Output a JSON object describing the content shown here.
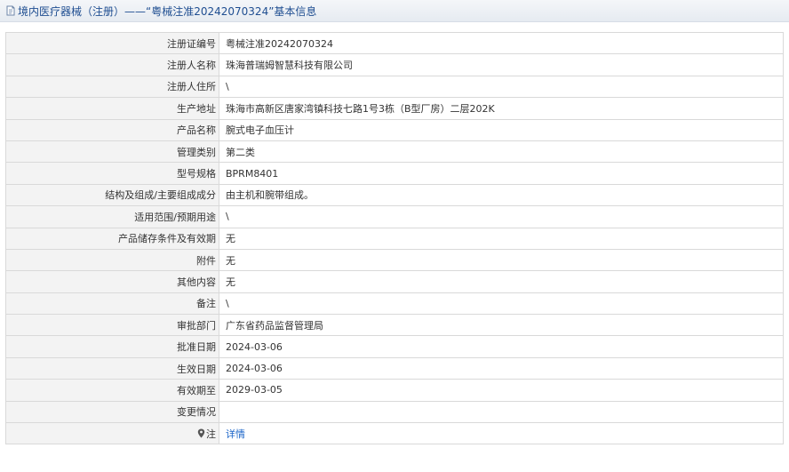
{
  "header": {
    "title": "境内医疗器械（注册）——“粤械注准20242070324”基本信息"
  },
  "rows": [
    {
      "label": "注册证编号",
      "value": "粤械注准20242070324"
    },
    {
      "label": "注册人名称",
      "value": "珠海普瑞姆智慧科技有限公司"
    },
    {
      "label": "注册人住所",
      "value": "\\"
    },
    {
      "label": "生产地址",
      "value": "珠海市高新区唐家湾镇科技七路1号3栋（B型厂房）二层202K"
    },
    {
      "label": "产品名称",
      "value": "腕式电子血压计"
    },
    {
      "label": "管理类别",
      "value": "第二类"
    },
    {
      "label": "型号规格",
      "value": "BPRM8401"
    },
    {
      "label": "结构及组成/主要组成成分",
      "value": "由主机和腕带组成。"
    },
    {
      "label": "适用范围/预期用途",
      "value": "\\"
    },
    {
      "label": "产品储存条件及有效期",
      "value": "无"
    },
    {
      "label": "附件",
      "value": "无"
    },
    {
      "label": "其他内容",
      "value": "无"
    },
    {
      "label": "备注",
      "value": "\\"
    },
    {
      "label": "审批部门",
      "value": "广东省药品监督管理局"
    },
    {
      "label": "批准日期",
      "value": "2024-03-06"
    },
    {
      "label": "生效日期",
      "value": "2024-03-06"
    },
    {
      "label": "有效期至",
      "value": "2029-03-05"
    },
    {
      "label": "变更情况",
      "value": ""
    }
  ],
  "note_row": {
    "label": "注",
    "link": "详情"
  },
  "colors": {
    "title_text": "#1f4e91",
    "label_bg": "#f3f3f3",
    "border": "#d9d9d9",
    "link": "#1a64c8"
  },
  "icons": {
    "title": "document-icon",
    "note": "location-pin-icon"
  }
}
